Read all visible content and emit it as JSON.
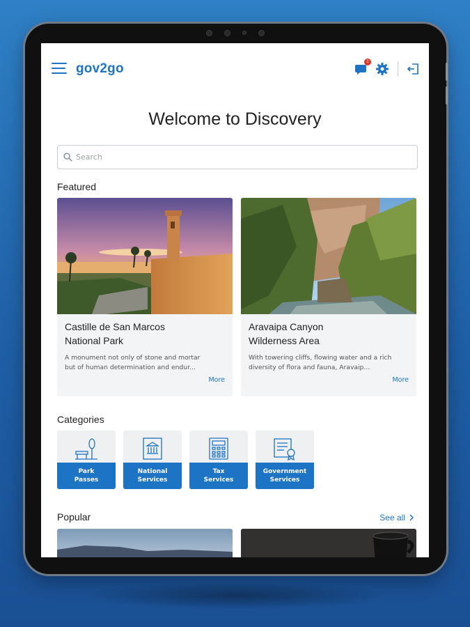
{
  "header": {
    "logo": "gov2go",
    "notification_count": "1"
  },
  "main": {
    "title": "Welcome to Discovery",
    "search_placeholder": "Search"
  },
  "featured": {
    "heading": "Featured",
    "cards": [
      {
        "title_line1": "Castille de San Marcos",
        "title_line2": "National Park",
        "desc_line1": "A monument not only of stone and mortar",
        "desc_line2": "but of human determination and endur...",
        "more": "More"
      },
      {
        "title_line1": "Aravaipa Canyon",
        "title_line2": "Wilderness Area",
        "desc_line1": "With towering cliffs, flowing water and a rich",
        "desc_line2": "diversity of flora and fauna, Aravaip...",
        "more": "More"
      }
    ]
  },
  "categories": {
    "heading": "Categories",
    "items": [
      {
        "line1": "Park",
        "line2": "Passes",
        "icon": "park-bench-icon"
      },
      {
        "line1": "National",
        "line2": "Services",
        "icon": "building-icon"
      },
      {
        "line1": "Tax",
        "line2": "Services",
        "icon": "calculator-icon"
      },
      {
        "line1": "Government",
        "line2": "Services",
        "icon": "certificate-icon"
      }
    ]
  },
  "popular": {
    "heading": "Popular",
    "see_all": "See all"
  },
  "colors": {
    "brand": "#1d73c4",
    "background": "#2f80c6",
    "badge": "#e0352b"
  }
}
